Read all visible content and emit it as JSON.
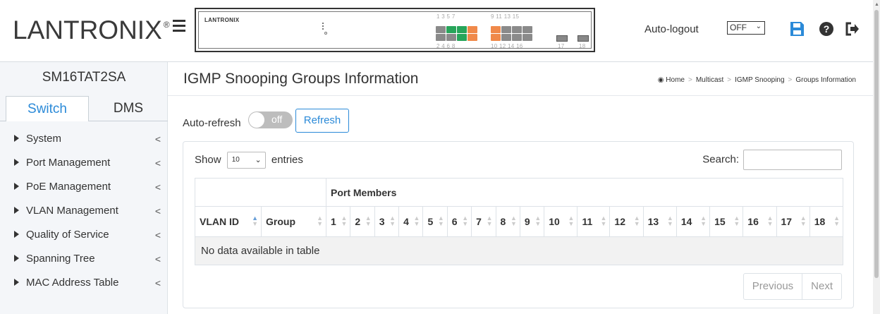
{
  "header": {
    "logo": "LANTRONIX",
    "logo_mark": "®",
    "panel_logo": "LANTRONIX",
    "port_numbers_top": "1  3  5  7",
    "port_numbers_top2": "9  11 13 15",
    "port_numbers_bottom": "2  4  6  8",
    "port_numbers_bottom2": "10 12 14 16",
    "sfp_label_17": "17",
    "sfp_label_18": "18",
    "auto_logout_label": "Auto-logout",
    "auto_logout_value": "OFF",
    "icons": [
      "save-icon",
      "help-icon",
      "logout-icon"
    ],
    "accent_color": "#2b8ad8"
  },
  "sidebar": {
    "device_name": "SM16TAT2SA",
    "tabs": [
      {
        "label": "Switch",
        "active": true
      },
      {
        "label": "DMS",
        "active": false
      }
    ],
    "items": [
      {
        "label": "System"
      },
      {
        "label": "Port Management"
      },
      {
        "label": "PoE Management"
      },
      {
        "label": "VLAN Management"
      },
      {
        "label": "Quality of Service"
      },
      {
        "label": "Spanning Tree"
      },
      {
        "label": "MAC Address Table"
      }
    ]
  },
  "main": {
    "title": "IGMP Snooping Groups Information",
    "breadcrumb": [
      "Home",
      "Multicast",
      "IGMP Snooping",
      "Groups Information"
    ],
    "auto_refresh_label": "Auto-refresh",
    "toggle_text": "off",
    "refresh_label": "Refresh",
    "show_label": "Show",
    "entries_value": "10",
    "entries_label": "entries",
    "search_label": "Search:",
    "port_members_header": "Port Members",
    "columns": [
      "VLAN ID",
      "Group",
      "1",
      "2",
      "3",
      "4",
      "5",
      "6",
      "7",
      "8",
      "9",
      "10",
      "11",
      "12",
      "13",
      "14",
      "15",
      "16",
      "17",
      "18"
    ],
    "empty_text": "No data available in table",
    "previous_label": "Previous",
    "next_label": "Next"
  }
}
